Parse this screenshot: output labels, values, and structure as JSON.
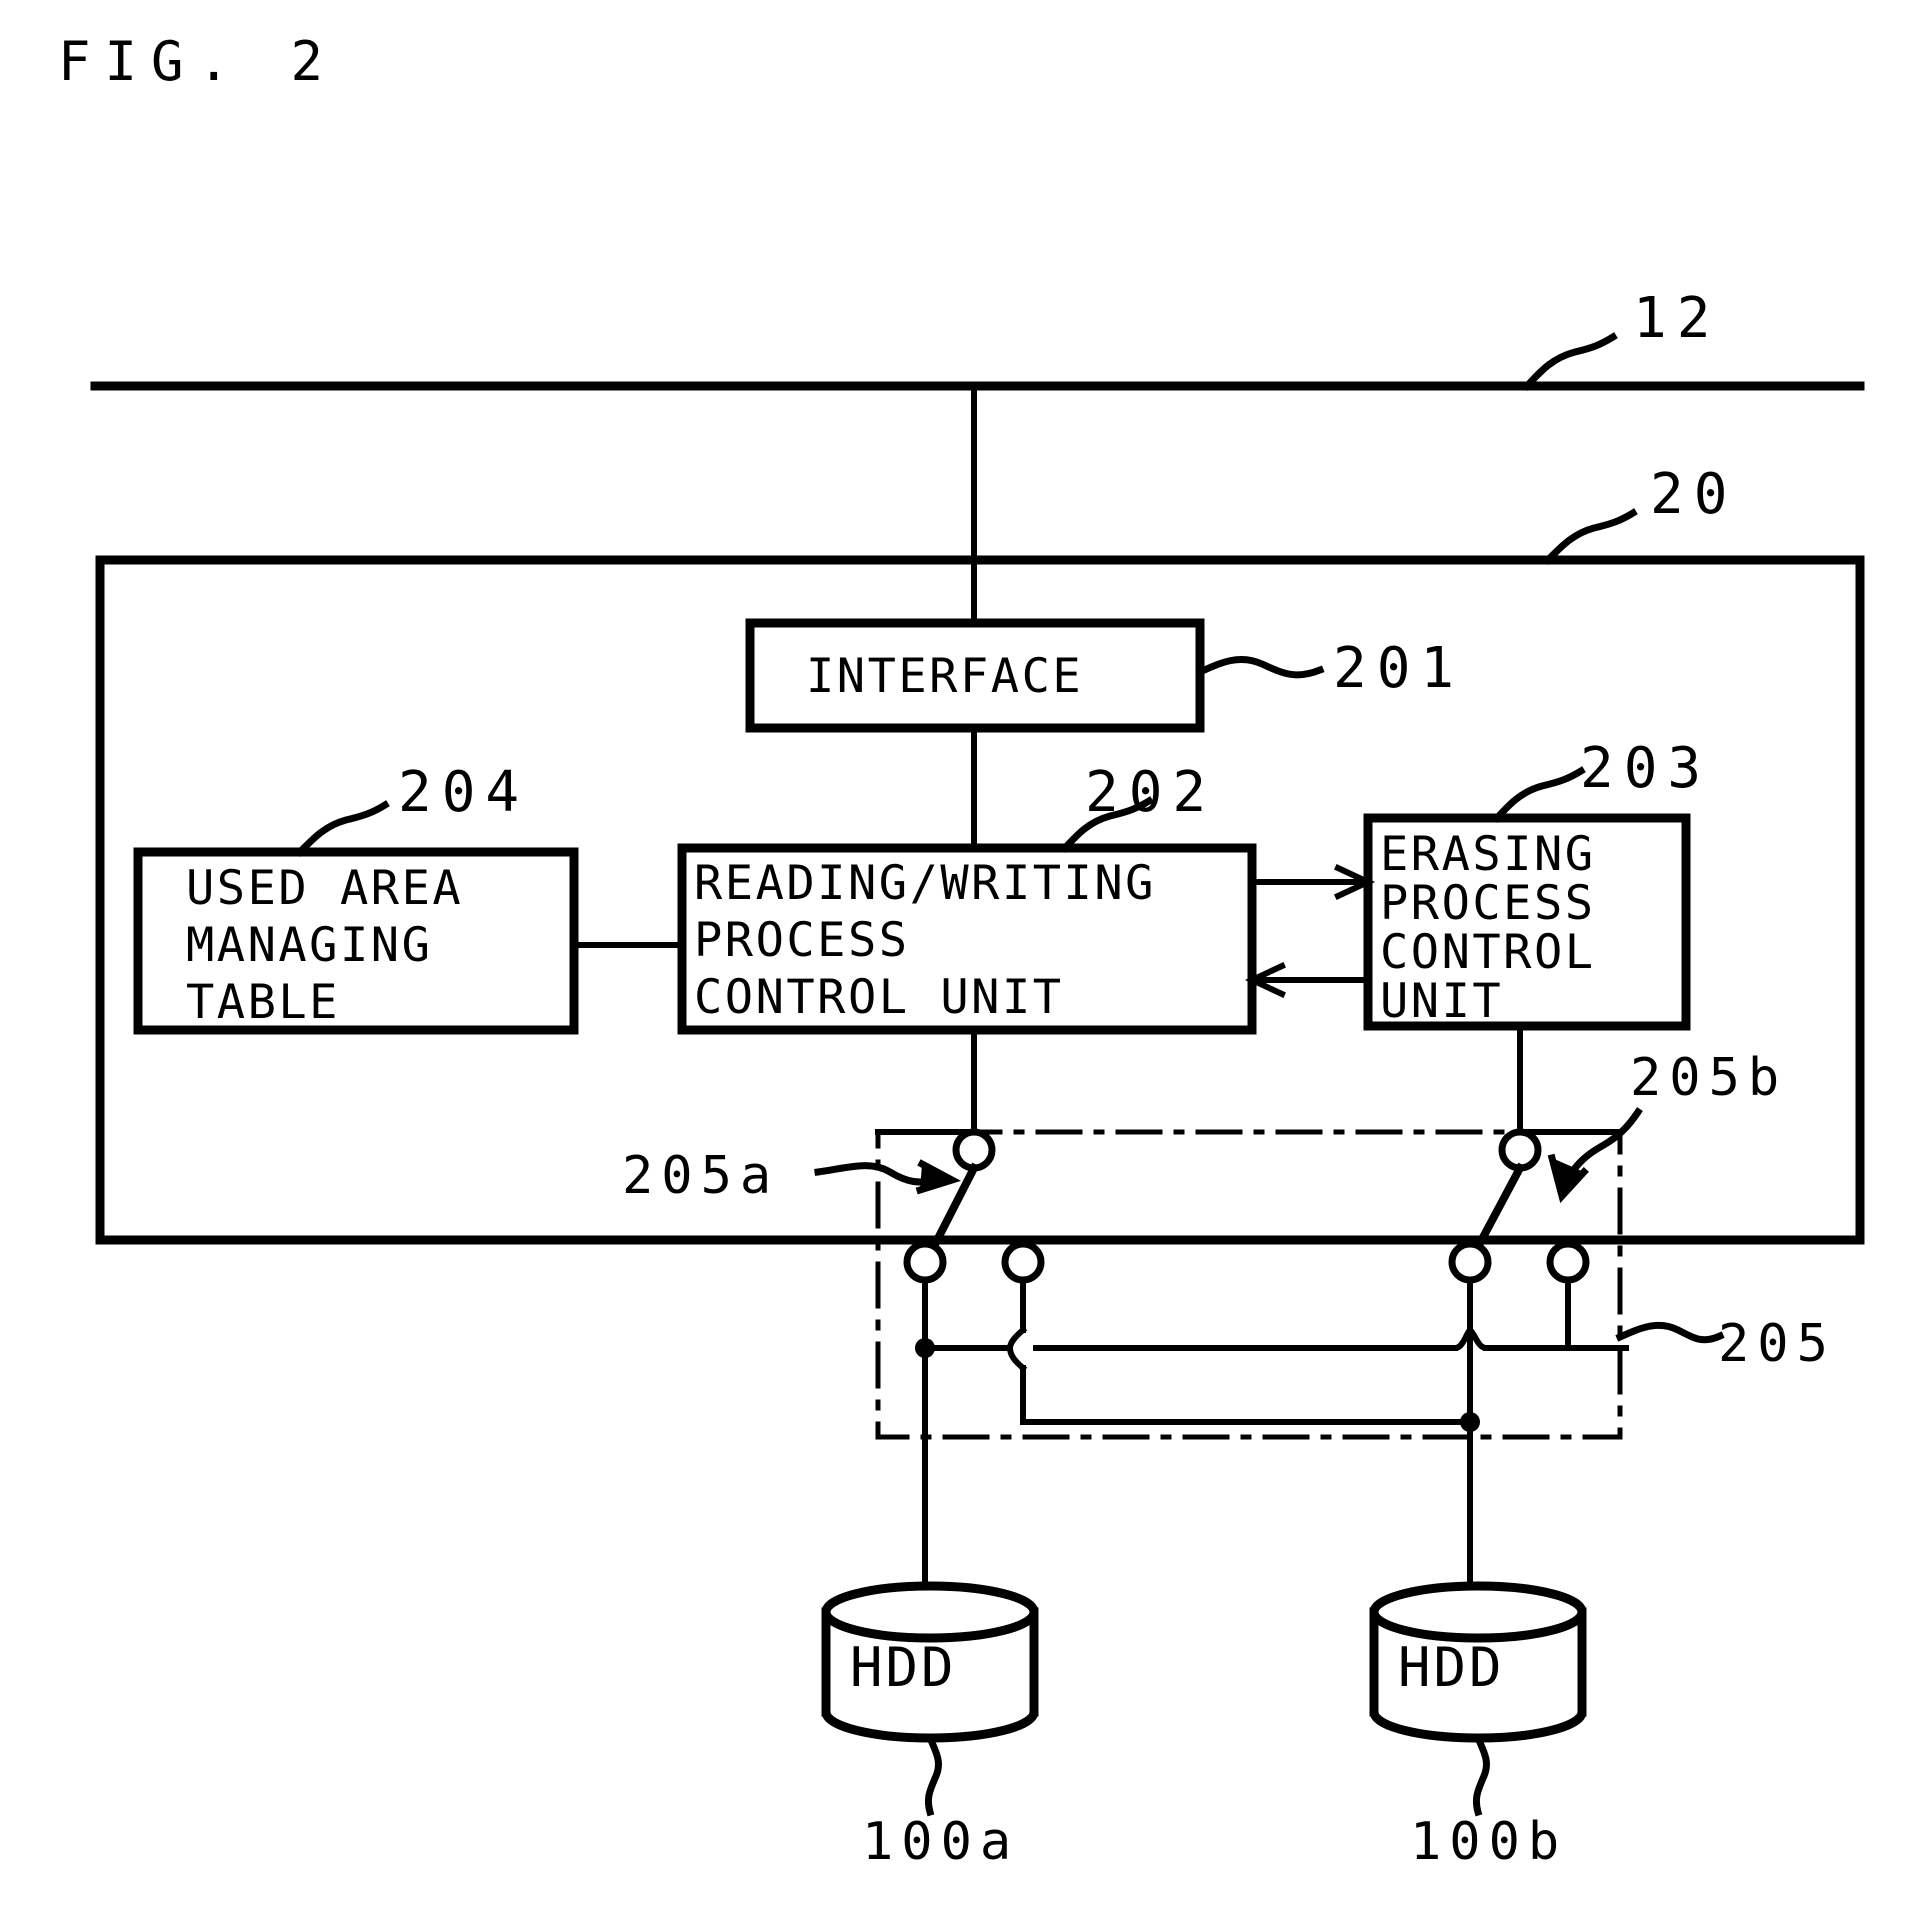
{
  "figure": {
    "title": "FIG. 2",
    "type": "patent-block-diagram"
  },
  "labels": {
    "bus_12": "12",
    "controller_20": "20",
    "interface_201": "201",
    "rw_unit_202": "202",
    "erasing_unit_203": "203",
    "used_area_table_204": "204",
    "switch_block_205": "205",
    "switch_a_205a": "205a",
    "switch_b_205b": "205b",
    "hdd_a_100a": "100a",
    "hdd_b_100b": "100b"
  },
  "blocks": {
    "interface": {
      "text": "INTERFACE"
    },
    "reading_writing": {
      "line1": "READING/WRITING",
      "line2": "PROCESS",
      "line3": "CONTROL UNIT"
    },
    "erasing": {
      "line1": "ERASING",
      "line2": "PROCESS",
      "line3": "CONTROL",
      "line4": "UNIT"
    },
    "used_area": {
      "line1": "USED AREA",
      "line2": "MANAGING",
      "line3": "TABLE"
    },
    "hdd_a": {
      "text": "HDD"
    },
    "hdd_b": {
      "text": "HDD"
    }
  },
  "colors": {
    "ink": "#000000",
    "paper": "#ffffff"
  }
}
